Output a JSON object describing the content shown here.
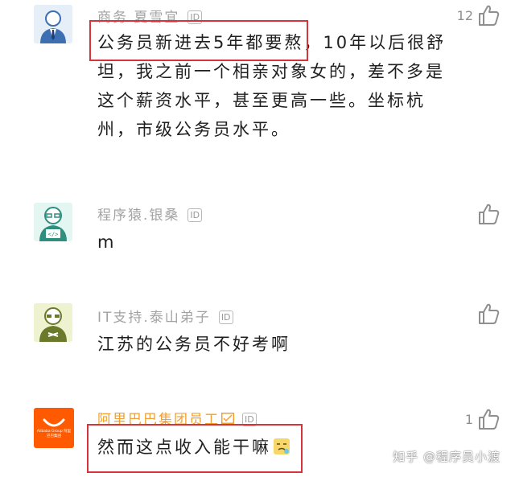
{
  "comments": [
    {
      "name": "商务.夏雪宜",
      "id_badge": "ID",
      "text": "公务员新进去5年都要熬，10年以后很舒坦，我之前一个相亲对象女的，差不多是这个薪资水平，甚至更高一些。坐标杭州，市级公务员水平。",
      "likes": "12",
      "avatar_icon": "businessman-avatar-icon"
    },
    {
      "name": "程序猿.银桑",
      "id_badge": "ID",
      "text": "m",
      "likes": "",
      "avatar_icon": "programmer-avatar-icon"
    },
    {
      "name": "IT支持.泰山弟子",
      "id_badge": "ID",
      "text": "江苏的公务员不好考啊",
      "likes": "",
      "avatar_icon": "it-support-avatar-icon"
    },
    {
      "name": "阿里巴巴集团员工",
      "id_badge": "ID",
      "text": "然而这点收入能干嘛",
      "likes": "1",
      "avatar_icon": "alibaba-logo",
      "avatar_text": "Alibaba Group 阿里巴巴集团"
    }
  ],
  "watermark": "知乎 @程序员小渡",
  "colors": {
    "name_gray": "#a3a3a3",
    "name_orange": "#f0a030",
    "highlight_red": "#d6343a",
    "alibaba_orange": "#ff5a00"
  }
}
